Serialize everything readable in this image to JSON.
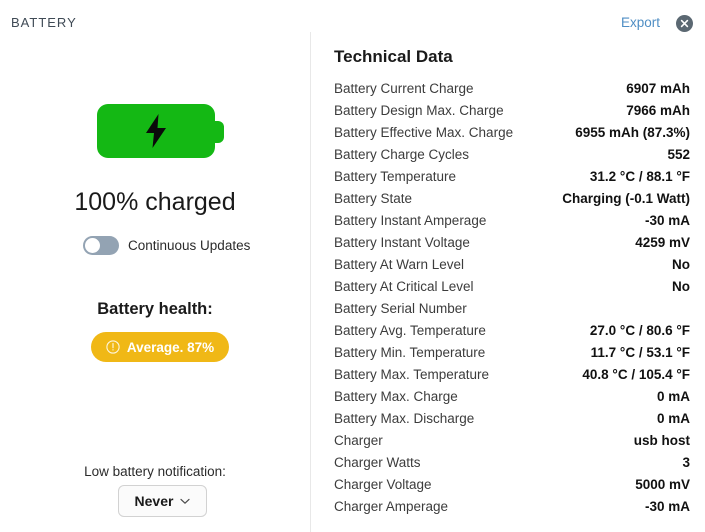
{
  "header": {
    "app_title": "BATTERY",
    "export_label": "Export",
    "close_icon": "close-circle-icon"
  },
  "left_panel": {
    "battery_icon": "battery-charging-icon",
    "bolt_icon": "lightning-bolt-icon",
    "charge_text": "100% charged",
    "continuous_updates_label": "Continuous Updates",
    "continuous_updates_state": "off",
    "health_title": "Battery health:",
    "health_badge_icon": "warning-circle-icon",
    "health_badge_label": "Average. 87%",
    "health_badge_color": "#f0b816",
    "low_battery_label": "Low battery notification:",
    "low_battery_value": "Never",
    "low_battery_chevron_icon": "chevron-down-icon",
    "battery_color": "#14b814"
  },
  "right_panel": {
    "title": "Technical Data",
    "rows": [
      {
        "label": "Battery Current Charge",
        "value": "6907 mAh"
      },
      {
        "label": "Battery Design Max. Charge",
        "value": "7966 mAh"
      },
      {
        "label": "Battery Effective Max. Charge",
        "value": "6955 mAh (87.3%)"
      },
      {
        "label": "Battery Charge Cycles",
        "value": "552"
      },
      {
        "label": "Battery Temperature",
        "value": "31.2 °C / 88.1 °F"
      },
      {
        "label": "Battery State",
        "value": "Charging (-0.1 Watt)"
      },
      {
        "label": "Battery Instant Amperage",
        "value": "-30 mA"
      },
      {
        "label": "Battery Instant Voltage",
        "value": "4259 mV"
      },
      {
        "label": "Battery At Warn Level",
        "value": "No"
      },
      {
        "label": "Battery At Critical Level",
        "value": "No"
      },
      {
        "label": "Battery Serial Number",
        "value": ""
      },
      {
        "label": "Battery Avg. Temperature",
        "value": "27.0 °C / 80.6 °F"
      },
      {
        "label": "Battery Min. Temperature",
        "value": "11.7 °C / 53.1 °F"
      },
      {
        "label": "Battery Max. Temperature",
        "value": "40.8 °C / 105.4 °F"
      },
      {
        "label": "Battery Max. Charge",
        "value": "0 mA"
      },
      {
        "label": "Battery Max. Discharge",
        "value": "0 mA"
      },
      {
        "label": "Charger",
        "value": "usb host"
      },
      {
        "label": "Charger Watts",
        "value": "3"
      },
      {
        "label": "Charger Voltage",
        "value": "5000 mV"
      },
      {
        "label": "Charger Amperage",
        "value": "-30 mA"
      }
    ]
  }
}
